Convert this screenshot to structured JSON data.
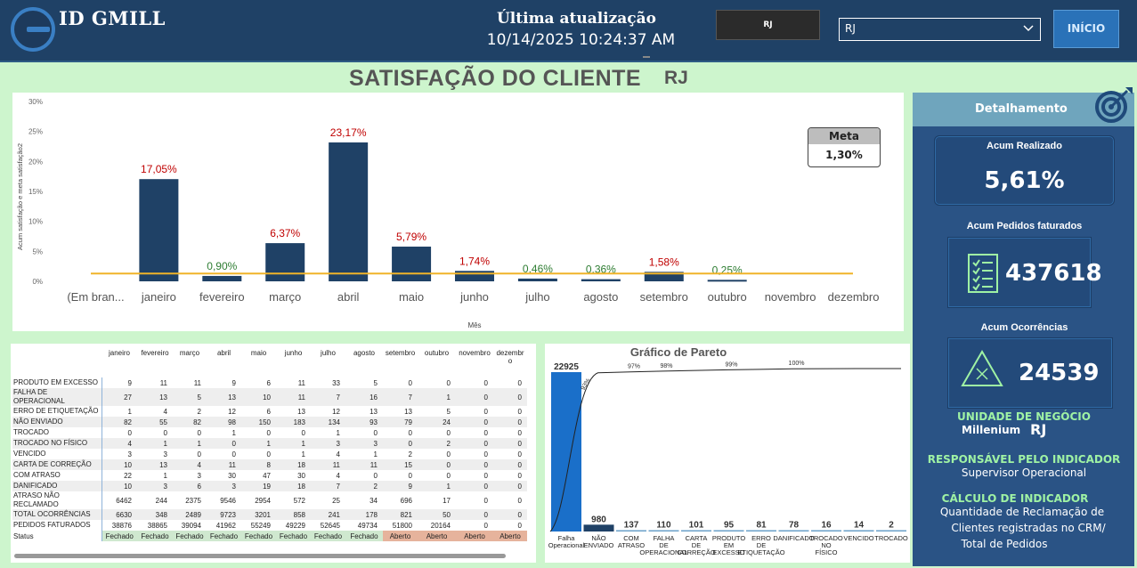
{
  "header": {
    "brand": "ID GMILL",
    "update_title": "Última atualização",
    "update_datetime": "10/14/2025 10:24:37 AM",
    "region_box": "RJ",
    "region_select": "RJ",
    "start_button": "INÍCIO"
  },
  "page": {
    "title": "SATISFAÇÃO DO CLIENTE",
    "region": "RJ"
  },
  "meta": {
    "label": "Meta",
    "value": "1,30%"
  },
  "chart_data": {
    "type": "bar",
    "xlabel": "Mês",
    "ylabel": "Acum satisfação e meta satisfação2",
    "ylim": [
      0,
      30
    ],
    "yticks": [
      "0%",
      "5%",
      "10%",
      "15%",
      "20%",
      "25%",
      "30%"
    ],
    "categories": [
      "(Em bran...",
      "janeiro",
      "fevereiro",
      "março",
      "abril",
      "maio",
      "junho",
      "julho",
      "agosto",
      "setembro",
      "outubro",
      "novembro",
      "dezembro"
    ],
    "values": [
      null,
      17.05,
      0.9,
      6.37,
      23.17,
      5.79,
      1.74,
      0.46,
      0.36,
      1.58,
      0.25,
      null,
      null
    ],
    "labels": [
      "",
      "17,05%",
      "0,90%",
      "6,37%",
      "23,17%",
      "5,79%",
      "1,74%",
      "0,46%",
      "0,36%",
      "1,58%",
      "0,25%",
      "",
      ""
    ],
    "label_colors": [
      "",
      "#c00000",
      "#2e7d32",
      "#c00000",
      "#c00000",
      "#c00000",
      "#c00000",
      "#2e7d32",
      "#2e7d32",
      "#c00000",
      "#2e7d32",
      "",
      ""
    ],
    "meta_line": 1.3,
    "bar_color": "#1f4166",
    "meta_color": "#f0b429"
  },
  "table": {
    "months": [
      "janeiro",
      "fevereiro",
      "março",
      "abril",
      "maio",
      "junho",
      "julho",
      "agosto",
      "setembro",
      "outubro",
      "novembro",
      "dezembr o"
    ],
    "rows": [
      {
        "label": "PRODUTO EM EXCESSO",
        "values": [
          "9",
          "11",
          "11",
          "9",
          "6",
          "11",
          "33",
          "5",
          "0",
          "0",
          "0",
          "0"
        ]
      },
      {
        "label": "FALHA DE OPERACIONAL",
        "values": [
          "27",
          "13",
          "5",
          "13",
          "10",
          "11",
          "7",
          "16",
          "7",
          "1",
          "0",
          "0"
        ]
      },
      {
        "label": "ERRO DE ETIQUETAÇÃO",
        "values": [
          "1",
          "4",
          "2",
          "12",
          "6",
          "13",
          "12",
          "13",
          "13",
          "5",
          "0",
          "0"
        ]
      },
      {
        "label": "NÃO ENVIADO",
        "values": [
          "82",
          "55",
          "82",
          "98",
          "150",
          "183",
          "134",
          "93",
          "79",
          "24",
          "0",
          "0"
        ]
      },
      {
        "label": "TROCADO",
        "values": [
          "0",
          "0",
          "0",
          "1",
          "0",
          "0",
          "1",
          "0",
          "0",
          "0",
          "0",
          "0"
        ]
      },
      {
        "label": "TROCADO NO FÍSICO",
        "values": [
          "4",
          "1",
          "1",
          "0",
          "1",
          "1",
          "3",
          "3",
          "0",
          "2",
          "0",
          "0"
        ]
      },
      {
        "label": "VENCIDO",
        "values": [
          "3",
          "3",
          "0",
          "0",
          "0",
          "1",
          "4",
          "1",
          "2",
          "0",
          "0",
          "0"
        ]
      },
      {
        "label": "CARTA DE CORREÇÃO",
        "values": [
          "10",
          "13",
          "4",
          "11",
          "8",
          "18",
          "11",
          "11",
          "15",
          "0",
          "0",
          "0"
        ]
      },
      {
        "label": "COM ATRASO",
        "values": [
          "22",
          "1",
          "3",
          "30",
          "47",
          "30",
          "4",
          "0",
          "0",
          "0",
          "0",
          "0"
        ]
      },
      {
        "label": "DANIFICADO",
        "values": [
          "10",
          "3",
          "6",
          "3",
          "19",
          "18",
          "7",
          "2",
          "9",
          "1",
          "0",
          "0"
        ]
      },
      {
        "label": "ATRASO NÃO RECLAMADO",
        "values": [
          "6462",
          "244",
          "2375",
          "9546",
          "2954",
          "572",
          "25",
          "34",
          "696",
          "17",
          "0",
          "0"
        ]
      },
      {
        "label": "TOTAL OCORRÊNCIAS",
        "values": [
          "6630",
          "348",
          "2489",
          "9723",
          "3201",
          "858",
          "241",
          "178",
          "821",
          "50",
          "0",
          "0"
        ]
      },
      {
        "label": "PEDIDOS FATURADOS",
        "values": [
          "38876",
          "38865",
          "39094",
          "41962",
          "55249",
          "49229",
          "52645",
          "49734",
          "51800",
          "20164",
          "0",
          "0"
        ]
      }
    ],
    "status_label": "Status",
    "status": [
      "Fechado",
      "Fechado",
      "Fechado",
      "Fechado",
      "Fechado",
      "Fechado",
      "Fechado",
      "Fechado",
      "Aberto",
      "Aberto",
      "Aberto",
      "Aberto"
    ]
  },
  "pareto": {
    "title": "Gráfico de Pareto",
    "categories": [
      "Falha Operacional",
      "NÃO ENVIADO",
      "COM ATRASO",
      "FALHA DE OPERACIONAL",
      "CARTA DE CORREÇÃO",
      "PRODUTO EM EXCESSO",
      "ERRO DE ETIQUETAÇÃO",
      "DANIFICADO",
      "TROCADO NO FÍSICO",
      "VENCIDO",
      "TROCADO"
    ],
    "values": [
      22925,
      980,
      137,
      110,
      101,
      95,
      81,
      78,
      16,
      14,
      2
    ],
    "cum_labels": [
      "93%",
      "97%",
      "98%",
      "99%",
      "100%"
    ],
    "colors": {
      "first": "#1a6fc9",
      "second": "#1f4166",
      "rest": "#6aa0c8"
    }
  },
  "panel": {
    "title": "Detalhamento",
    "realizado_label": "Acum Realizado",
    "realizado_value": "5,61%",
    "pedidos_label": "Acum Pedidos faturados",
    "pedidos_value": "437618",
    "ocorr_label": "Acum Ocorrências",
    "ocorr_value": "24539",
    "unidade_hd": "UNIDADE DE NEGÓCIO",
    "unidade_tx": "Millenium",
    "unidade_rj": "RJ",
    "resp_hd": "RESPONSÁVEL PELO INDICADOR",
    "resp_tx": "Supervisor Operacional",
    "calc_hd": "CÁLCULO DE INDICADOR",
    "calc_tx1": "Quantidade de Reclamação de",
    "calc_tx2": "Clientes registradas no CRM/",
    "calc_tx3": "Total de Pedidos"
  }
}
